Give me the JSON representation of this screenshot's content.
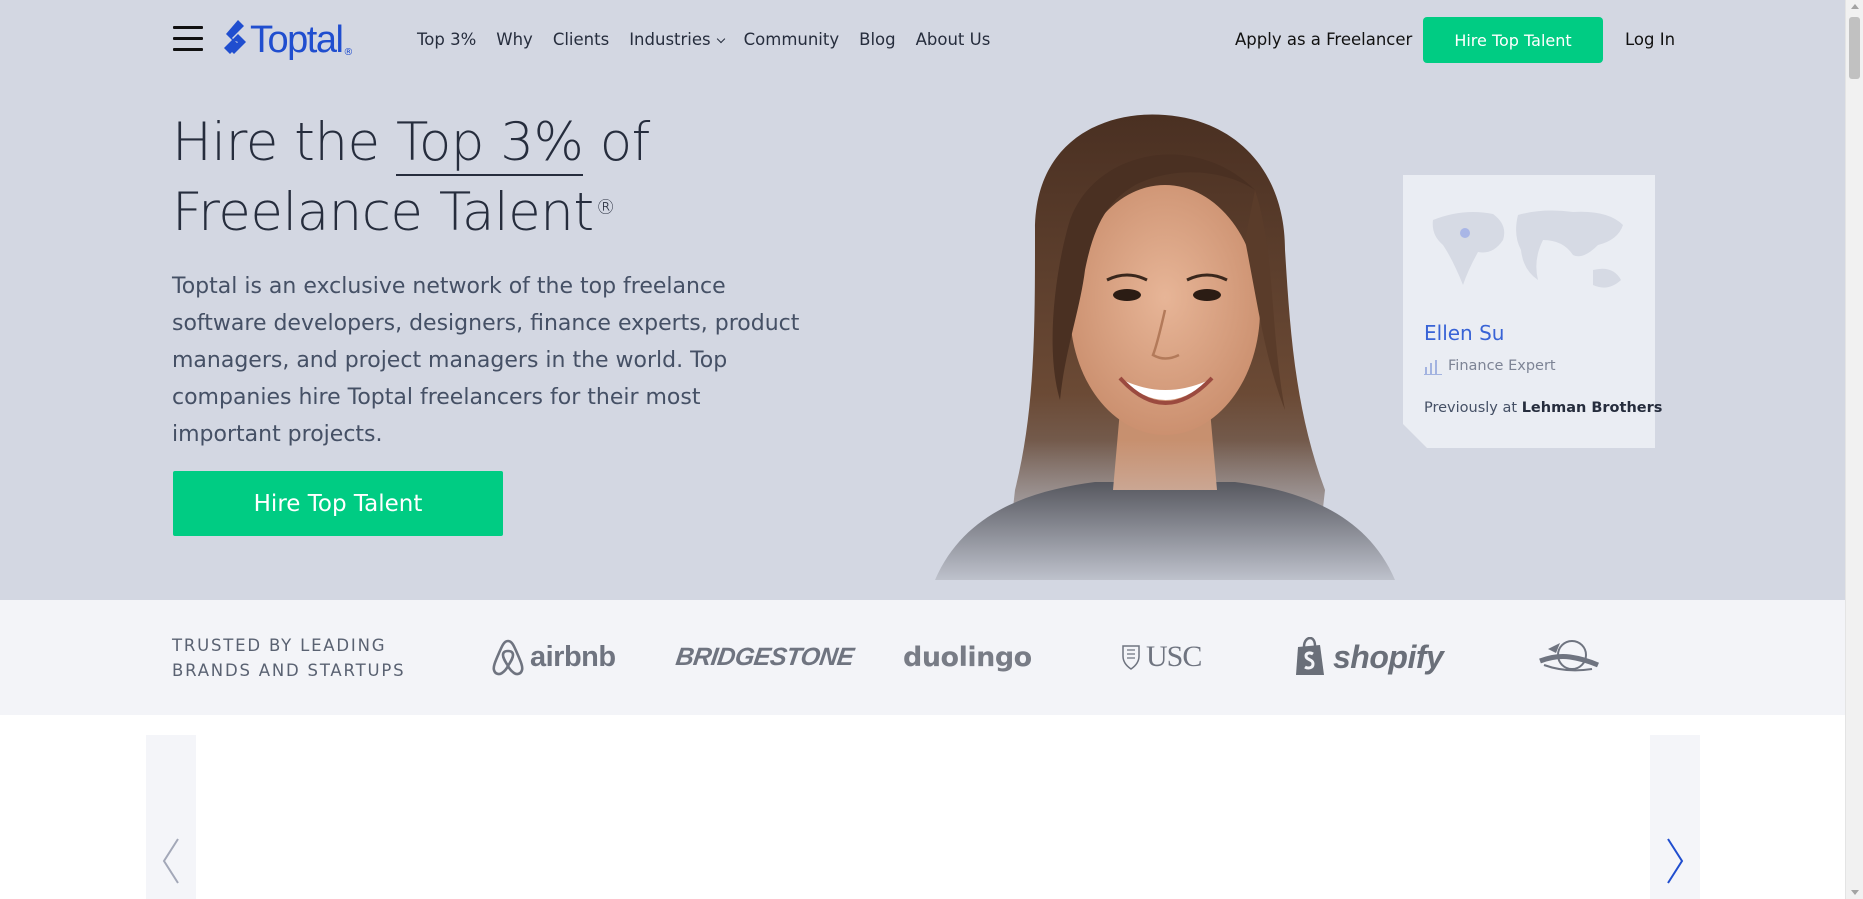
{
  "header": {
    "logo_text": "Toptal",
    "logo_reg": "®",
    "nav": [
      {
        "label": "Top 3%"
      },
      {
        "label": "Why"
      },
      {
        "label": "Clients"
      },
      {
        "label": "Industries"
      },
      {
        "label": "Community"
      },
      {
        "label": "Blog"
      },
      {
        "label": "About Us"
      }
    ],
    "apply_label": "Apply as a Freelancer",
    "hire_label": "Hire Top Talent",
    "login_label": "Log In"
  },
  "hero": {
    "headline_pre": "Hire the ",
    "headline_highlight": "Top 3%",
    "headline_post": " of",
    "headline_line2": "Freelance Talent",
    "headline_reg": "®",
    "lead": "Toptal is an exclusive network of the top freelance software developers, designers, finance experts, product managers, and project managers in the world. Top companies hire Toptal freelancers for their most important projects.",
    "cta_label": "Hire Top Talent"
  },
  "profile_card": {
    "name": "Ellen Su",
    "role": "Finance Expert",
    "previously_prefix": "Previously at ",
    "previously_company": "Lehman Brothers"
  },
  "trusted": {
    "label": "TRUSTED BY LEADING BRANDS AND STARTUPS",
    "brands": [
      "airbnb",
      "BRIDGESTONE",
      "duolingo",
      "USC",
      "shopify"
    ]
  },
  "colors": {
    "brand_blue": "#204ecf",
    "accent_green": "#00cc83",
    "hero_bg": "#d3d7e2",
    "card_name": "#3863d6"
  }
}
